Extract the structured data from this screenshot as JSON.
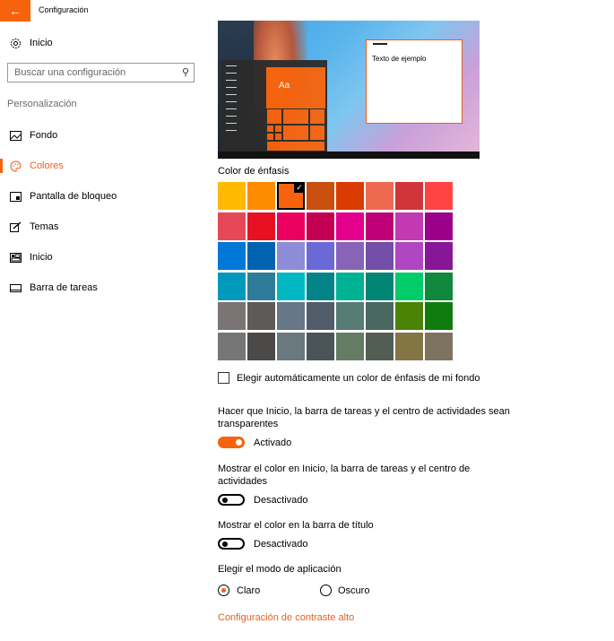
{
  "window": {
    "title": "Configuración",
    "back_icon": "back-arrow-icon"
  },
  "sidebar": {
    "home_label": "Inicio",
    "search_placeholder": "Buscar una configuración",
    "section_header": "Personalización",
    "items": [
      {
        "label": "Fondo",
        "icon": "picture-icon",
        "active": false
      },
      {
        "label": "Colores",
        "icon": "palette-icon",
        "active": true
      },
      {
        "label": "Pantalla de bloqueo",
        "icon": "lock-screen-icon",
        "active": false
      },
      {
        "label": "Temas",
        "icon": "themes-brush-icon",
        "active": false
      },
      {
        "label": "Inicio",
        "icon": "start-icon",
        "active": false
      },
      {
        "label": "Barra de tareas",
        "icon": "taskbar-icon",
        "active": false
      }
    ]
  },
  "preview": {
    "sample_text": "Texto de ejemplo",
    "tile_text": "Aa",
    "accent": "#f7630c"
  },
  "accent_section": {
    "label": "Color de énfasis",
    "selected_index": 2,
    "colors": [
      "#ffb900",
      "#ff8c00",
      "#f7630c",
      "#ca5010",
      "#da3b01",
      "#ef6950",
      "#d13438",
      "#ff4343",
      "#e74856",
      "#e81123",
      "#ea005e",
      "#c30052",
      "#e3008c",
      "#bf0077",
      "#c239b3",
      "#9a0089",
      "#0078d7",
      "#0063b1",
      "#8e8cd8",
      "#6b69d6",
      "#8764b8",
      "#744da9",
      "#b146c2",
      "#881798",
      "#0099bc",
      "#2d7d9a",
      "#00b7c3",
      "#038387",
      "#00b294",
      "#018574",
      "#00cc6a",
      "#10893e",
      "#7a7574",
      "#5d5a58",
      "#68768a",
      "#515c6b",
      "#567c73",
      "#486860",
      "#498205",
      "#107c10",
      "#767676",
      "#4c4a48",
      "#69797e",
      "#4a5459",
      "#647c64",
      "#525e54",
      "#847545",
      "#7e735f"
    ]
  },
  "auto_accent": {
    "label": "Elegir automáticamente un color de énfasis de mi fondo",
    "checked": false
  },
  "transparency": {
    "label": "Hacer que Inicio, la barra de tareas y el centro de actividades sean transparentes",
    "state": "Activado",
    "on": true
  },
  "color_start": {
    "label": "Mostrar el color en Inicio, la barra de tareas y el centro de actividades",
    "state": "Desactivado",
    "on": false
  },
  "color_title": {
    "label": "Mostrar el color en la barra de título",
    "state": "Desactivado",
    "on": false
  },
  "app_mode": {
    "label": "Elegir el modo de aplicación",
    "options": [
      {
        "label": "Claro",
        "selected": true
      },
      {
        "label": "Oscuro",
        "selected": false
      }
    ]
  },
  "high_contrast_link": "Configuración de contraste alto"
}
